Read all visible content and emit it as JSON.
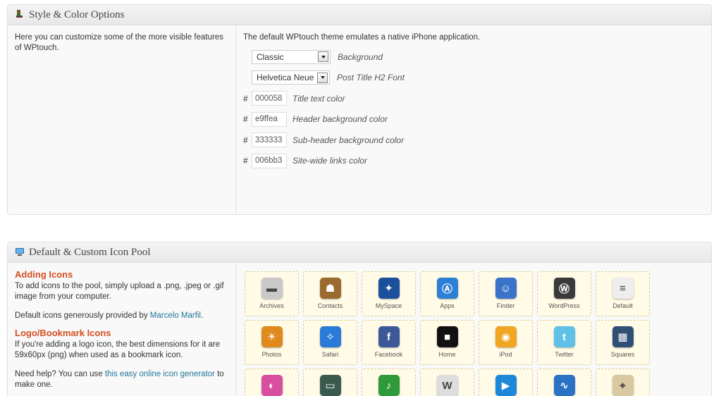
{
  "style_panel": {
    "title": "Style & Color Options",
    "left_desc": "Here you can customize some of the more visible features of WPtouch.",
    "right_desc": "The default WPtouch theme emulates a native iPhone application.",
    "background": {
      "value": "Classic",
      "label": "Background"
    },
    "font": {
      "value": "Helvetica Neue",
      "label": "Post Title H2 Font"
    },
    "colors": [
      {
        "hash": "#",
        "value": "000058",
        "label": "Title text color"
      },
      {
        "hash": "#",
        "value": "e9ffea",
        "label": "Header background color"
      },
      {
        "hash": "#",
        "value": "333333",
        "label": "Sub-header background color"
      },
      {
        "hash": "#",
        "value": "006bb3",
        "label": "Site-wide links color"
      }
    ]
  },
  "icon_panel": {
    "title": "Default & Custom Icon Pool",
    "adding_heading": "Adding Icons",
    "adding_text": "To add icons to the pool, simply upload a .png, .jpeg or .gif image from your computer.",
    "credit_prefix": "Default icons generously provided by ",
    "credit_link": "Marcelo Marfil",
    "credit_suffix": ".",
    "logo_heading": "Logo/Bookmark Icons",
    "logo_text": "If you're adding a logo icon, the best dimensions for it are 59x60px (png) when used as a bookmark icon.",
    "help_prefix": "Need help? You can use ",
    "help_link": "this easy online icon generator",
    "help_suffix": " to make one.",
    "icons": [
      {
        "name": "Archives",
        "icon": "archives-icon",
        "color": "#c9c9c9"
      },
      {
        "name": "Contacts",
        "icon": "contacts-icon",
        "color": "#9a6a2e"
      },
      {
        "name": "MySpace",
        "icon": "myspace-icon",
        "color": "#1c4f9c"
      },
      {
        "name": "Apps",
        "icon": "apps-icon",
        "color": "#2d7fd6"
      },
      {
        "name": "Finder",
        "icon": "finder-icon",
        "color": "#3a74c8"
      },
      {
        "name": "WordPress",
        "icon": "wordpress-icon",
        "color": "#3a3a3a"
      },
      {
        "name": "Default",
        "icon": "default-icon",
        "color": "#eeeeee"
      },
      {
        "name": "Photos",
        "icon": "photos-icon",
        "color": "#e08a1e"
      },
      {
        "name": "Safari",
        "icon": "safari-icon",
        "color": "#2a7ad8"
      },
      {
        "name": "Facebook",
        "icon": "facebook-icon",
        "color": "#3b5998"
      },
      {
        "name": "Home",
        "icon": "home-icon",
        "color": "#111111"
      },
      {
        "name": "iPod",
        "icon": "ipod-icon",
        "color": "#f0a623"
      },
      {
        "name": "Twitter",
        "icon": "twitter-icon",
        "color": "#5fc1e8"
      },
      {
        "name": "Squares",
        "icon": "squares-icon",
        "color": "#2f4f75"
      },
      {
        "name": "",
        "icon": "color-wheel-icon",
        "color": "#d94fa0"
      },
      {
        "name": "",
        "icon": "card-icon",
        "color": "#3a5a4e"
      },
      {
        "name": "",
        "icon": "microphone-icon",
        "color": "#2f9a3a"
      },
      {
        "name": "",
        "icon": "wikipedia-icon",
        "color": "#dddddd"
      },
      {
        "name": "",
        "icon": "video-icon",
        "color": "#1e88d8"
      },
      {
        "name": "",
        "icon": "stocks-icon",
        "color": "#2a72c4"
      },
      {
        "name": "",
        "icon": "maps-icon",
        "color": "#d8c9a0"
      }
    ]
  }
}
